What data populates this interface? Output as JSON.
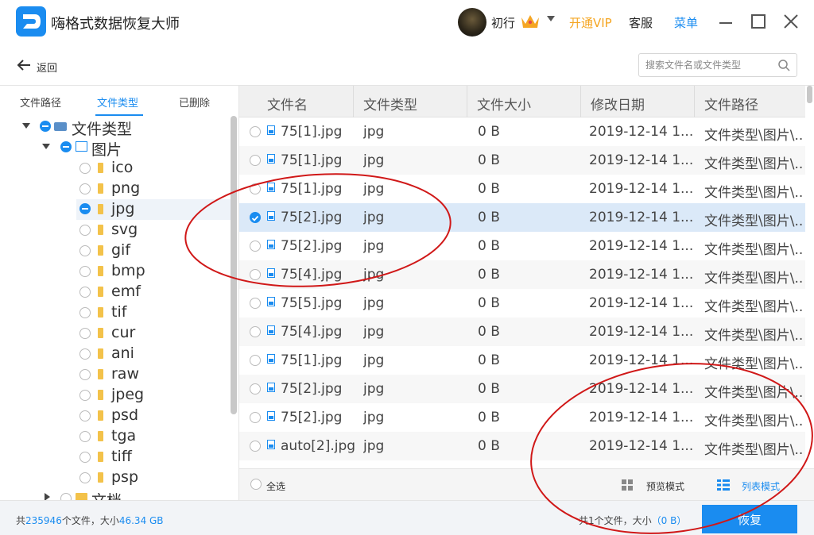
{
  "app": {
    "title": "嗨格式数据恢复大师",
    "username": "初行",
    "vip_label": "开通VIP",
    "service_label": "客服",
    "menu_label": "菜单"
  },
  "nav": {
    "back_label": "返回",
    "search_placeholder": "搜索文件名或文件类型"
  },
  "left_tabs": [
    "文件路径",
    "文件类型",
    "已删除"
  ],
  "tree": {
    "root": "文件类型",
    "images": "图片",
    "image_types": [
      "ico",
      "png",
      "jpg",
      "svg",
      "gif",
      "bmp",
      "emf",
      "tif",
      "cur",
      "ani",
      "raw",
      "jpeg",
      "psd",
      "tga",
      "tiff",
      "psp"
    ],
    "selected_type": "jpg",
    "next_group": "文档"
  },
  "table": {
    "headers": [
      "文件名",
      "文件类型",
      "文件大小",
      "修改日期",
      "文件路径"
    ],
    "rows": [
      {
        "name": "75[1].jpg",
        "type": "jpg",
        "size": "0 B",
        "date": "2019-12-14 1...",
        "path": "文件类型\\图片\\..."
      },
      {
        "name": "75[1].jpg",
        "type": "jpg",
        "size": "0 B",
        "date": "2019-12-14 1...",
        "path": "文件类型\\图片\\..."
      },
      {
        "name": "75[1].jpg",
        "type": "jpg",
        "size": "0 B",
        "date": "2019-12-14 1...",
        "path": "文件类型\\图片\\..."
      },
      {
        "name": "75[2].jpg",
        "type": "jpg",
        "size": "0 B",
        "date": "2019-12-14 1...",
        "path": "文件类型\\图片\\...",
        "checked": true
      },
      {
        "name": "75[2].jpg",
        "type": "jpg",
        "size": "0 B",
        "date": "2019-12-14 1...",
        "path": "文件类型\\图片\\..."
      },
      {
        "name": "75[4].jpg",
        "type": "jpg",
        "size": "0 B",
        "date": "2019-12-14 1...",
        "path": "文件类型\\图片\\..."
      },
      {
        "name": "75[5].jpg",
        "type": "jpg",
        "size": "0 B",
        "date": "2019-12-14 1...",
        "path": "文件类型\\图片\\..."
      },
      {
        "name": "75[4].jpg",
        "type": "jpg",
        "size": "0 B",
        "date": "2019-12-14 1...",
        "path": "文件类型\\图片\\..."
      },
      {
        "name": "75[1].jpg",
        "type": "jpg",
        "size": "0 B",
        "date": "2019-12-14 1...",
        "path": "文件类型\\图片\\..."
      },
      {
        "name": "75[2].jpg",
        "type": "jpg",
        "size": "0 B",
        "date": "2019-12-14 1...",
        "path": "文件类型\\图片\\..."
      },
      {
        "name": "75[2].jpg",
        "type": "jpg",
        "size": "0 B",
        "date": "2019-12-14 1...",
        "path": "文件类型\\图片\\..."
      },
      {
        "name": "auto[2].jpg",
        "type": "jpg",
        "size": "0 B",
        "date": "2019-12-14 1...",
        "path": "文件类型\\图片\\..."
      }
    ]
  },
  "table_footer": {
    "select_all": "全选",
    "preview_mode": "预览模式",
    "list_mode": "列表模式"
  },
  "status": {
    "total_prefix": "共",
    "total_count": "235946",
    "total_mid": "个文件，大小",
    "total_size": "46.34 GB",
    "selected_text": "共1个文件，大小",
    "selected_size": "（0 B）",
    "recover_button": "恢复"
  },
  "colors": {
    "accent": "#1a8cf0",
    "vip": "#f5a623",
    "annotation": "#d01818"
  }
}
